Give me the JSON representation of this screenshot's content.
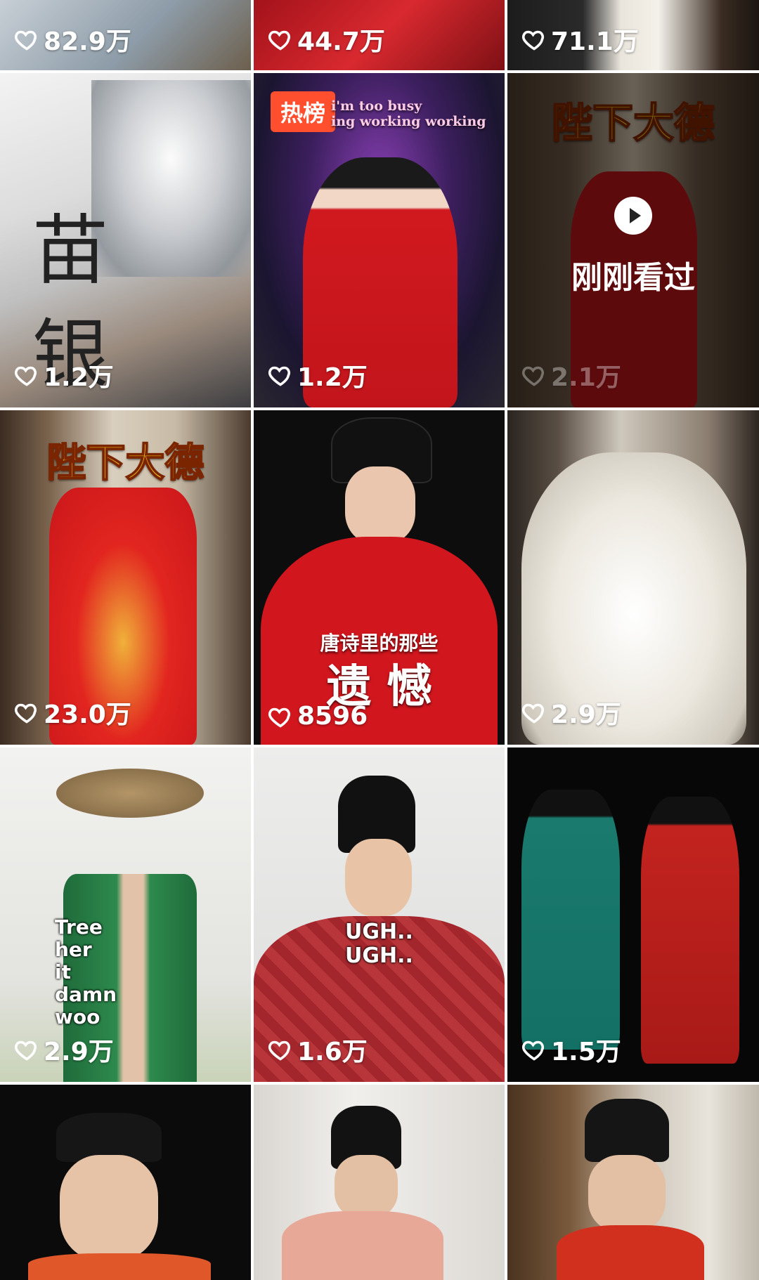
{
  "feed": {
    "tiles": [
      {
        "likes": "82.9万"
      },
      {
        "likes": "44.7万"
      },
      {
        "likes": "71.1万"
      },
      {
        "likes": "1.2万",
        "caption": "苗\n银"
      },
      {
        "likes": "1.2万",
        "badge": "热榜",
        "caption": "i'm too busy\ning working working"
      },
      {
        "likes": "2.1万",
        "caption": "陛下大德",
        "watched": "刚刚看过"
      },
      {
        "likes": "23.0万",
        "caption": "陛下大德"
      },
      {
        "likes": "8596",
        "caption_small": "唐诗里的那些",
        "caption_big": "遗 憾"
      },
      {
        "likes": "2.9万"
      },
      {
        "likes": "2.9万",
        "caption": "Tree\nher\nit\ndamn\nwoo"
      },
      {
        "likes": "1.6万",
        "caption": "UGH..\nUGH.."
      },
      {
        "likes": "1.5万"
      },
      {
        "likes": ""
      },
      {
        "likes": ""
      },
      {
        "likes": ""
      }
    ]
  },
  "colors": {
    "like_text": "#ffffff",
    "hot_badge": "#ff4f2e",
    "gold_caption": "#ffd21a"
  }
}
